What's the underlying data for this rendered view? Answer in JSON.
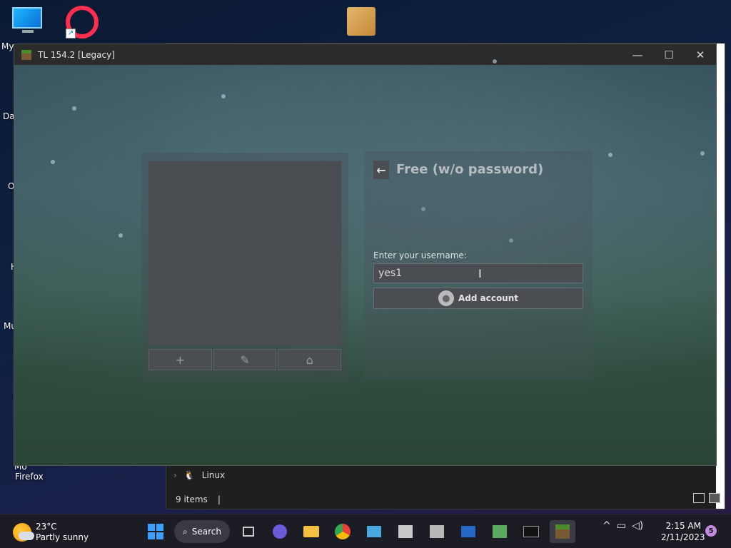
{
  "desktop": {
    "icons": [
      {
        "name": "this-pc",
        "label": "My"
      },
      {
        "name": "opera",
        "label": ""
      },
      {
        "name": "package",
        "label": ""
      }
    ],
    "edge_labels": [
      "Dat",
      "O",
      "H",
      "Mu",
      "Mo",
      "Firefox"
    ]
  },
  "tl_window": {
    "title": "TL 154.2 [Legacy]",
    "controls": {
      "minimize": "—",
      "maximize": "☐",
      "close": "✕"
    },
    "form": {
      "title": "Free (w/o password)",
      "username_label": "Enter your username:",
      "username_value": "yes1",
      "add_button": "Add account"
    },
    "account_buttons": [
      "+",
      "✎",
      "⌂"
    ]
  },
  "explorer": {
    "tree_item": "Linux",
    "status": "9 items"
  },
  "taskbar": {
    "weather_temp": "23°C",
    "weather_desc": "Partly sunny",
    "search_label": "Search",
    "time": "2:15 AM",
    "date": "2/11/2023",
    "notification_count": "5"
  },
  "colors": {
    "window_bg": "#2a2d33",
    "panel": "#4a4d52",
    "taskbar": "#1c1c24"
  }
}
